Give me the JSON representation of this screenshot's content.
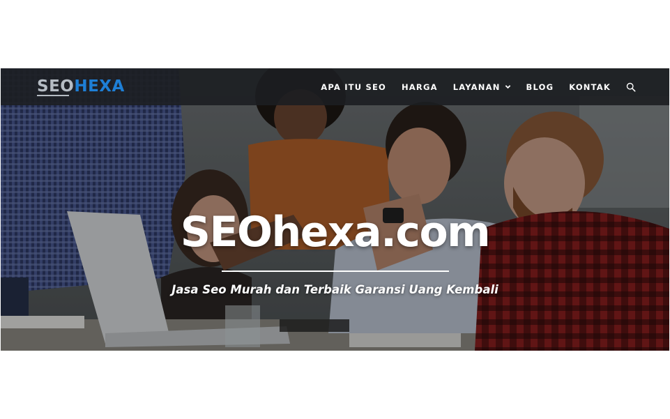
{
  "brand": {
    "logo_part1": "SEO",
    "logo_part2": "HEXA",
    "accent_color": "#1e7fd6",
    "logo_gray": "#b5bcc4"
  },
  "nav": {
    "items": [
      {
        "label": "APA ITU SEO"
      },
      {
        "label": "HARGA"
      },
      {
        "label": "LAYANAN",
        "has_dropdown": true
      },
      {
        "label": "BLOG"
      },
      {
        "label": "KONTAK"
      }
    ],
    "search_icon": "search-icon",
    "dropdown_icon": "chevron-down-icon"
  },
  "hero": {
    "title": "SEOhexa.com",
    "subtitle": "Jasa Seo Murah dan Terbaik Garansi Uang Kembali",
    "background": "team-meeting-photo"
  }
}
